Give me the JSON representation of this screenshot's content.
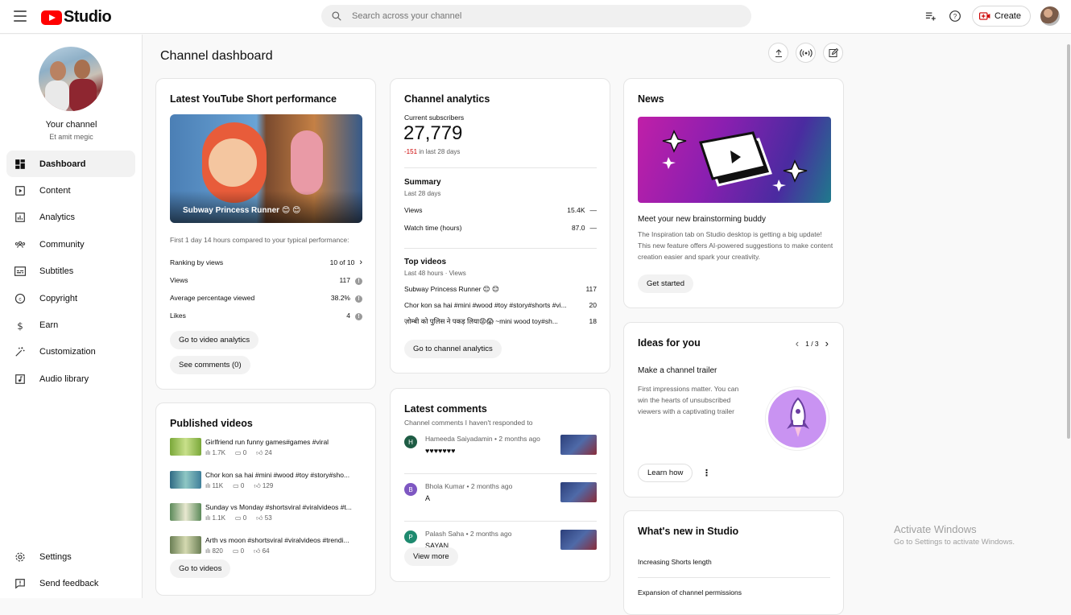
{
  "header": {
    "logo_text": "Studio",
    "search_placeholder": "Search across your channel",
    "create_label": "Create"
  },
  "sidebar": {
    "your_channel": "Your channel",
    "channel_name": "Et amit megic",
    "items": [
      {
        "label": "Dashboard",
        "icon": "dashboard-icon",
        "active": true
      },
      {
        "label": "Content",
        "icon": "content-icon"
      },
      {
        "label": "Analytics",
        "icon": "analytics-icon"
      },
      {
        "label": "Community",
        "icon": "community-icon"
      },
      {
        "label": "Subtitles",
        "icon": "subtitles-icon"
      },
      {
        "label": "Copyright",
        "icon": "copyright-icon"
      },
      {
        "label": "Earn",
        "icon": "earn-icon"
      },
      {
        "label": "Customization",
        "icon": "customization-icon"
      },
      {
        "label": "Audio library",
        "icon": "audio-library-icon"
      }
    ],
    "bottom": [
      {
        "label": "Settings",
        "icon": "gear-icon"
      },
      {
        "label": "Send feedback",
        "icon": "feedback-icon"
      }
    ]
  },
  "page": {
    "title": "Channel dashboard"
  },
  "short_card": {
    "title": "Latest YouTube Short performance",
    "video_title": "Subway Princess Runner 😊 😊",
    "compare_text": "First 1 day 14 hours compared to your typical performance:",
    "stats": [
      {
        "label": "Ranking by views",
        "value": "10 of 10"
      },
      {
        "label": "Views",
        "value": "117"
      },
      {
        "label": "Average percentage viewed",
        "value": "38.2%"
      },
      {
        "label": "Likes",
        "value": "4"
      }
    ],
    "btn_analytics": "Go to video analytics",
    "btn_comments": "See comments (0)"
  },
  "published": {
    "title": "Published videos",
    "items": [
      {
        "title": "Girlfriend run funny games#games #viral",
        "views": "1.7K",
        "comments": "0",
        "likes": "24",
        "thumb_color": "#7aa83a"
      },
      {
        "title": "Chor kon sa hai #mini #wood #toy #story#sho...",
        "views": "11K",
        "comments": "0",
        "likes": "129",
        "thumb_color": "#3f7f9a"
      },
      {
        "title": "Sunday vs Monday #shortsviral #viralvideos #t...",
        "views": "1.1K",
        "comments": "0",
        "likes": "53",
        "thumb_color": "#5c8a5a"
      },
      {
        "title": "Arth vs moon #shortsviral #viralvideos #trendi...",
        "views": "820",
        "comments": "0",
        "likes": "64",
        "thumb_color": "#6b7f55"
      }
    ],
    "btn": "Go to videos"
  },
  "analytics": {
    "title": "Channel analytics",
    "subs_label": "Current subscribers",
    "subs_value": "27,779",
    "subs_change": "-151",
    "subs_change_suffix": "in last 28 days",
    "summary_title": "Summary",
    "summary_period": "Last 28 days",
    "summary": [
      {
        "label": "Views",
        "value": "15.4K",
        "trend": "—"
      },
      {
        "label": "Watch time (hours)",
        "value": "87.0",
        "trend": "—"
      }
    ],
    "top_title": "Top videos",
    "top_period": "Last 48 hours · Views",
    "top": [
      {
        "title": "Subway Princess Runner 😊 😊",
        "value": "117"
      },
      {
        "title": "Chor kon sa hai #mini #wood #toy #story#shorts #vi...",
        "value": "20"
      },
      {
        "title": "ज़ोम्बी को पुलिस ने पकड़ लिया😡😱 ~mini wood toy#sh...",
        "value": "18"
      }
    ],
    "btn": "Go to channel analytics"
  },
  "comments": {
    "title": "Latest comments",
    "subtitle": "Channel comments I haven't responded to",
    "items": [
      {
        "initial": "H",
        "author": "Hameeda Saiyadamin",
        "time": "• 2 months ago",
        "text": "♥♥♥♥♥♥♥",
        "color": "#1e5c44"
      },
      {
        "initial": "B",
        "author": "Bhola Kumar",
        "time": "• 2 months ago",
        "text": "A",
        "color": "#7e57c2"
      },
      {
        "initial": "P",
        "author": "Palash Saha",
        "time": "• 2 months ago",
        "text": "SAYAN",
        "color": "#1e8a6f"
      }
    ],
    "btn": "View more"
  },
  "news": {
    "title": "News",
    "headline": "Meet your new brainstorming buddy",
    "body": "The Inspiration tab on Studio desktop is getting a big update! This new feature offers AI-powered suggestions to make content creation easier and spark your creativity.",
    "btn": "Get started"
  },
  "ideas": {
    "title": "Ideas for you",
    "pager": "1 / 3",
    "headline": "Make a channel trailer",
    "body": "First impressions matter. You can win the hearts of unsubscribed viewers with a captivating trailer",
    "btn": "Learn how"
  },
  "whats_new": {
    "title": "What's new in Studio",
    "items": [
      "Increasing Shorts length",
      "Expansion of channel permissions"
    ]
  },
  "watermark": {
    "line1": "Activate Windows",
    "line2": "Go to Settings to activate Windows."
  }
}
